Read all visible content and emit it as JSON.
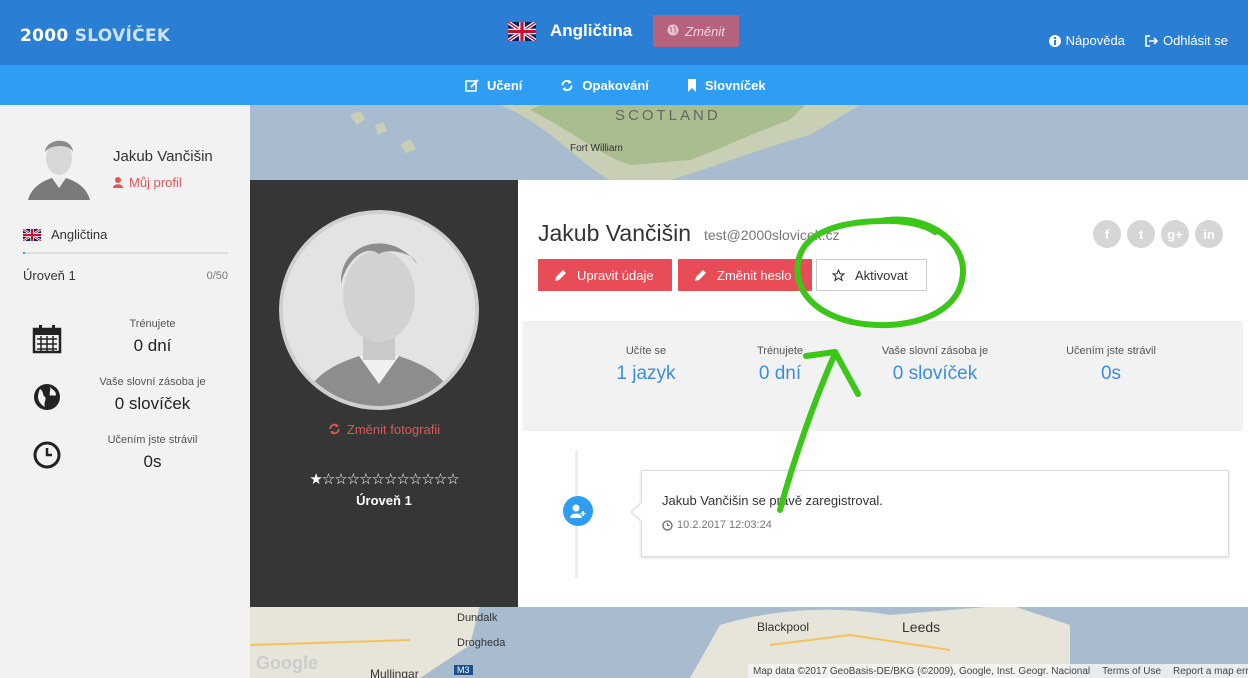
{
  "brand": {
    "part1": "2000",
    "part2": "SLOVÍČEK"
  },
  "header": {
    "language": "Angličtina",
    "change_label": "Změnit",
    "help_label": "Nápověda",
    "logout_label": "Odhlásit se"
  },
  "nav": [
    {
      "label": "Učení",
      "icon": "edit-icon"
    },
    {
      "label": "Opakování",
      "icon": "refresh-icon"
    },
    {
      "label": "Slovníček",
      "icon": "bookmark-icon"
    }
  ],
  "sidebar": {
    "user_name": "Jakub Vančišin",
    "profile_link": "Můj profil",
    "language": "Angličtina",
    "level": "Úroveň 1",
    "progress_count": "0/50",
    "progress_fraction": 0.0,
    "stats": [
      {
        "label": "Trénujete",
        "value": "0 dní",
        "icon": "calendar-icon"
      },
      {
        "label": "Vaše slovní zásoba je",
        "value": "0 slovíček",
        "icon": "globe-icon"
      },
      {
        "label": "Učením jste strávil",
        "value": "0s",
        "icon": "clock-icon"
      }
    ]
  },
  "profile": {
    "change_photo": "Změnit fotografii",
    "stars": "★☆☆☆☆☆☆☆☆☆☆☆",
    "rating": 1,
    "rating_max": 12,
    "level": "Úroveň 1",
    "name": "Jakub Vančišin",
    "email": "test@2000slovicek.cz",
    "buttons": {
      "edit": "Upravit údaje",
      "change_password": "Změnit heslo",
      "activate": "Aktivovat"
    },
    "social": [
      "f",
      "t",
      "g+",
      "in"
    ]
  },
  "stats": [
    {
      "label": "Učíte se",
      "value": "1 jazyk"
    },
    {
      "label": "Trénujete",
      "value": "0 dní"
    },
    {
      "label": "Vaše slovní zásoba je",
      "value": "0 slovíček"
    },
    {
      "label": "Učením jste strávil",
      "value": "0s"
    }
  ],
  "timeline": {
    "text": "Jakub Vančišin se právě zaregistroval.",
    "time": "10.2.2017 12:03:24"
  },
  "map": {
    "labels": [
      "SCOTLAND",
      "Fort William",
      "Dundalk",
      "Drogheda",
      "Blackpool",
      "Leeds",
      "Mullingar",
      "M3",
      "Google"
    ],
    "footer": {
      "data": "Map data ©2017 GeoBasis-DE/BKG (©2009), Google, Inst. Geogr. Nacional",
      "terms": "Terms of Use",
      "report": "Report a map error"
    }
  },
  "colors": {
    "topbar": "#2a7fd4",
    "navbar": "#2f9ef2",
    "accent_red": "#e84c57",
    "link_blue": "#3a8fdb",
    "annotation_green": "#3cc61a"
  }
}
